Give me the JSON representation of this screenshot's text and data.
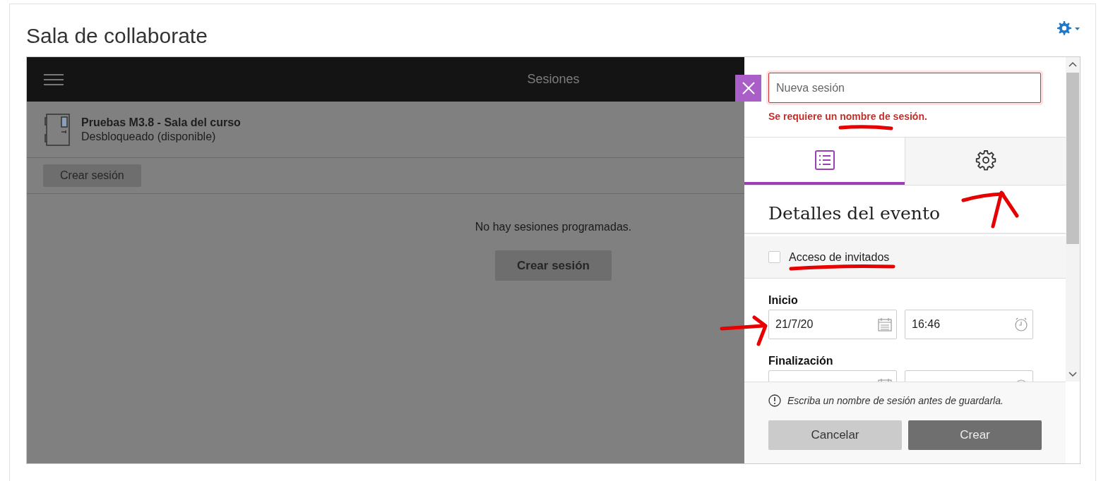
{
  "page": {
    "title": "Sala de collaborate"
  },
  "header": {
    "title": "Sesiones"
  },
  "room": {
    "name": "Pruebas M3.8 - Sala del curso",
    "status": "Desbloqueado (disponible)"
  },
  "toolbar_button": "Crear sesión",
  "empty_message": "No hay sesiones programadas.",
  "empty_button": "Crear sesión",
  "panel": {
    "name_field": {
      "placeholder": "Nueva sesión"
    },
    "error": "Se requiere un nombre de sesión.",
    "tabs": [
      {
        "kind": "details",
        "selected": true
      },
      {
        "kind": "settings",
        "selected": false
      }
    ],
    "section_title": "Detalles del evento",
    "guest_access": {
      "label": "Acceso de invitados",
      "checked": false
    },
    "start": {
      "label": "Inicio",
      "date": "21/7/20",
      "time": "16:46"
    },
    "end": {
      "label": "Finalización"
    },
    "notice": "Escriba un nombre de sesión antes de guardarla.",
    "buttons": [
      {
        "label": "Cancelar",
        "kind": "secondary"
      },
      {
        "label": "Crear",
        "kind": "primary"
      }
    ]
  }
}
